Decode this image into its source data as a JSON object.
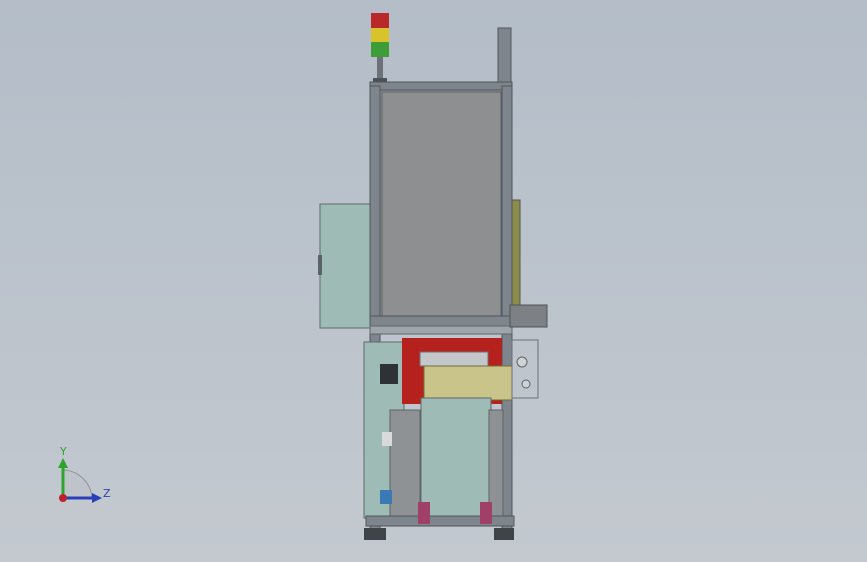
{
  "viewport": {
    "background_top": "#b4bdc8",
    "background_bottom": "#c3c9cf"
  },
  "model": {
    "frame_color": "#7e858c",
    "panel_gray": "#8d8f91",
    "glass_teal": "#9ebbb5",
    "accent_red": "#b5221d",
    "feeder_olive": "#c9c48a",
    "foot_pink": "#a0406a"
  },
  "signal_tower": {
    "colors": [
      "#b9292a",
      "#d8c32c",
      "#3f9d37"
    ]
  },
  "triad": {
    "y_label": "Y",
    "z_label": "Z",
    "y_color": "#2ea32e",
    "z_color": "#2b3fb8",
    "origin_color": "#c0202b"
  }
}
